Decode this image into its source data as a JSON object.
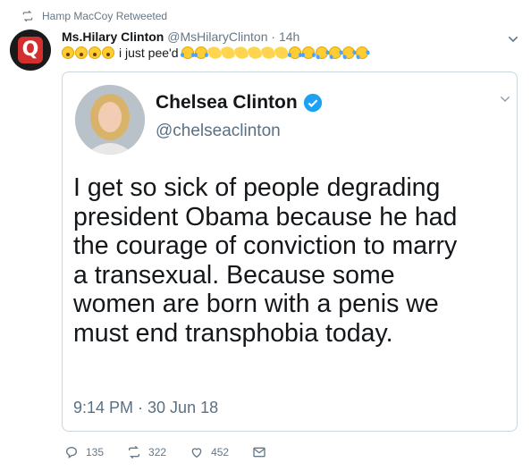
{
  "retweet": {
    "label": "Hamp MacCoy Retweeted"
  },
  "tweet": {
    "name": "Ms.Hilary Clinton",
    "handle": "@MsHilaryClinton",
    "separator": "·",
    "time": "14h",
    "text_prefix_emojis": [
      "astonished-face-emoji",
      "astonished-face-emoji",
      "astonished-face-emoji",
      "astonished-face-emoji"
    ],
    "text": "i just pee'd",
    "text_suffix_emojis": [
      "tears-of-joy-emoji",
      "tears-of-joy-emoji",
      "clapping-hands-emoji",
      "clapping-hands-emoji",
      "clapping-hands-emoji",
      "clapping-hands-emoji",
      "clapping-hands-emoji",
      "clapping-hands-emoji",
      "tears-of-joy-emoji",
      "tears-of-joy-emoji",
      "rolling-laughing-emoji",
      "rolling-laughing-emoji",
      "rolling-laughing-emoji",
      "rolling-laughing-emoji"
    ]
  },
  "quoted": {
    "name": "Chelsea Clinton",
    "handle": "@chelseaclinton",
    "lines": [
      "I get so sick of people degrading",
      "president Obama because he had",
      "the courage of conviction to marry",
      "a transexual.  Because some",
      "women are born with a penis we",
      "must end transphobia today."
    ],
    "timestamp": "9:14 PM · 30 Jun 18"
  },
  "actions": {
    "reply_count": "135",
    "retweet_count": "322",
    "like_count": "452"
  },
  "colors": {
    "verified": "#1da1f2",
    "secondary_text": "#657786",
    "border": "#ccd6dd"
  }
}
